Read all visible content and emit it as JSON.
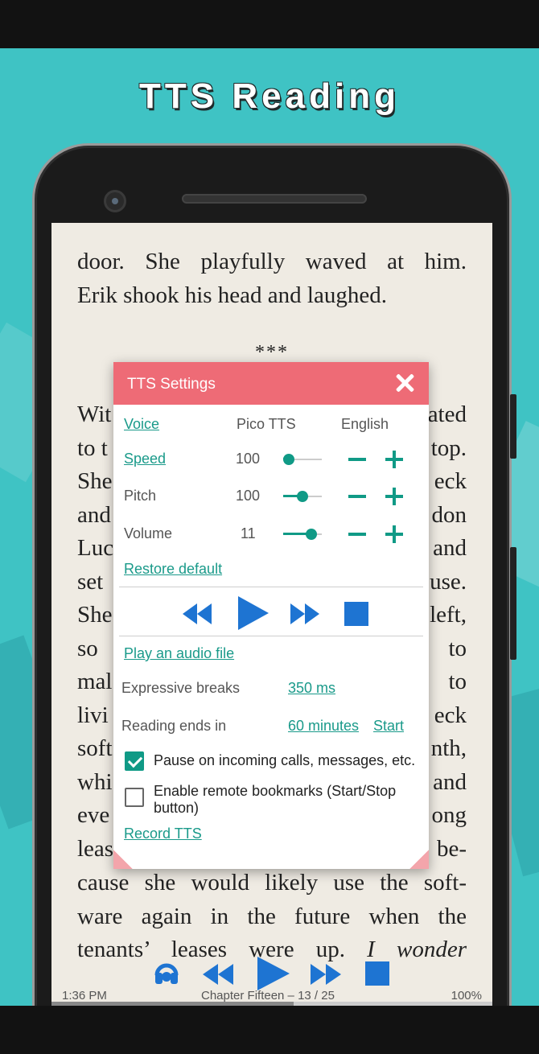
{
  "promo": {
    "title": "TTS Reading"
  },
  "book": {
    "lines_top": [
      "door. She playfully waved at him.",
      "Erik shook his head and laughed."
    ],
    "separator": "***",
    "left_fragments": [
      "Wit",
      "to t",
      "She",
      "and",
      "Luc",
      "set",
      "She",
      "so",
      "mal",
      "livi",
      "soft",
      "whi",
      "eve",
      "leas"
    ],
    "right_fragments": [
      "ated",
      "top.",
      "eck",
      "don",
      "and",
      "use.",
      "left,",
      "to",
      "to",
      "eck",
      "nth,",
      "and",
      "ong",
      "be-"
    ],
    "lines_bottom": [
      "cause she would likely use the soft-",
      "ware again in the future when the"
    ],
    "last_line_plain": "tenants’ leases were up. ",
    "last_line_italic": "I wonder"
  },
  "status": {
    "time": "1:36 PM",
    "chapter": "Chapter Fifteen – 13 / 25",
    "percent": "100%",
    "progress": 0.55
  },
  "dialog": {
    "title": "TTS Settings",
    "voice": {
      "label": "Voice",
      "engine": "Pico TTS",
      "language": "English"
    },
    "speed": {
      "label": "Speed",
      "value": "100",
      "level": 0.15
    },
    "pitch": {
      "label": "Pitch",
      "value": "100",
      "level": 0.5
    },
    "volume": {
      "label": "Volume",
      "value": "11",
      "level": 0.72
    },
    "restore_default": "Restore default",
    "play_audio": "Play an audio file",
    "expressive_breaks": {
      "label": "Expressive breaks",
      "value": "350 ms"
    },
    "reading_ends": {
      "label": "Reading ends in",
      "value": "60 minutes",
      "action": "Start"
    },
    "pause_calls": {
      "label": "Pause on incoming calls, messages, etc.",
      "checked": true
    },
    "remote_bookmarks": {
      "label": "Enable remote bookmarks (Start/Stop button)",
      "checked": false
    },
    "record_tts": "Record TTS"
  },
  "colors": {
    "accent": "#109a86",
    "header": "#ee6b76",
    "player_blue": "#1e74d2",
    "background": "#3fc3c4"
  },
  "icons": [
    "close-icon",
    "rewind-icon",
    "play-icon",
    "fast-forward-icon",
    "stop-icon",
    "minus-icon",
    "plus-icon",
    "headphones-icon"
  ]
}
